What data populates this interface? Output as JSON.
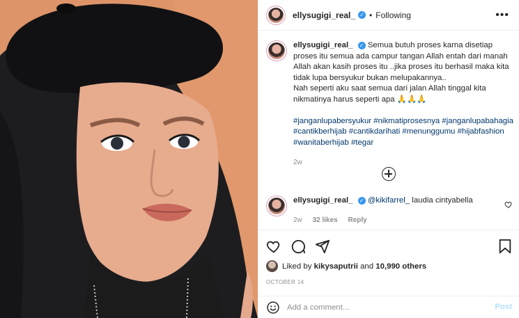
{
  "header": {
    "username": "ellysugigi_real_",
    "separator": "•",
    "follow_state": "Following",
    "more_glyph": "•••"
  },
  "caption": {
    "username": "ellysugigi_real_",
    "paragraph_1": "Semua butuh proses karna disetiap proses itu semua ada campur tangan Allah entah dari manah Allah akan kasih proses itu ..jika proses itu berhasil maka kita tidak lupa bersyukur bukan melupakannya..",
    "paragraph_2": "Nah seperti aku saat semua dari jalan Allah tinggal kita nikmatinya harus seperti apa 🙏🙏🙏",
    "hashtags": "#janganlupabersyukur #nikmatiprosesnya #janganlupabahagia #cantikberhijab #cantikdarihati #menunggumu #hijabfashion #wanitaberhijab #tegar",
    "time_ago": "2w"
  },
  "comment": {
    "username": "ellysugigi_real_",
    "mention": "@kikifarrel_",
    "text": " laudia cintyabella",
    "time_ago": "2w",
    "likes": "32 likes",
    "reply_label": "Reply"
  },
  "likes": {
    "prefix": "Liked by ",
    "user": "kikysaputrii",
    "middle": " and ",
    "others": "10,990 others"
  },
  "date": "OCTOBER 14",
  "add_comment": {
    "placeholder": "Add a comment...",
    "post_label": "Post"
  },
  "icons": [
    "verified-icon",
    "more-icon",
    "load-more-icon",
    "heart-icon",
    "comment-icon",
    "share-icon",
    "bookmark-icon",
    "emoji-icon"
  ],
  "colors": {
    "verified": "#3897f0",
    "link": "#00376b",
    "muted": "#8e8e8e",
    "post_disabled": "#b2dffc"
  }
}
